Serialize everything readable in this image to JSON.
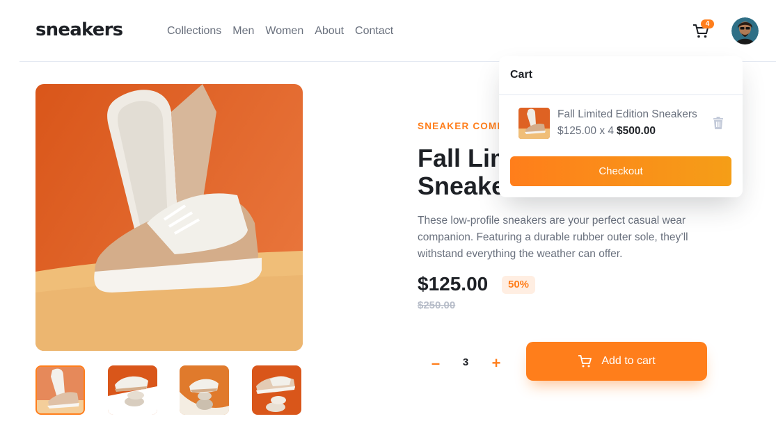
{
  "header": {
    "logo": "sneakers",
    "nav": [
      "Collections",
      "Men",
      "Women",
      "About",
      "Contact"
    ],
    "cart_count": "4"
  },
  "product": {
    "company": "SNEAKER COMPANY",
    "title": "Fall Limited Edition Sneakers",
    "description": "These low-profile sneakers are your perfect casual wear companion. Featuring a durable rubber outer sole, they’ll withstand everything the weather can offer.",
    "price": "$125.00",
    "discount": "50%",
    "original_price": "$250.00",
    "quantity": "3",
    "minus_label": "–",
    "plus_label": "+",
    "add_to_cart": "Add to cart"
  },
  "gallery": {
    "selected_index": 0,
    "thumbnail_count": 4
  },
  "cart": {
    "title": "Cart",
    "item": {
      "name": "Fall Limited Edition Sneakers",
      "unit_line": "$125.00 x 4",
      "total": "$500.00"
    },
    "checkout_label": "Checkout"
  },
  "colors": {
    "accent": "#ff7e1b",
    "accent_light": "#ffeee2",
    "dark": "#1d2025",
    "muted": "#69707d",
    "strike": "#b6bcc8"
  },
  "icons": [
    "cart-icon",
    "avatar-image",
    "trash-icon",
    "minus-icon",
    "plus-icon"
  ]
}
